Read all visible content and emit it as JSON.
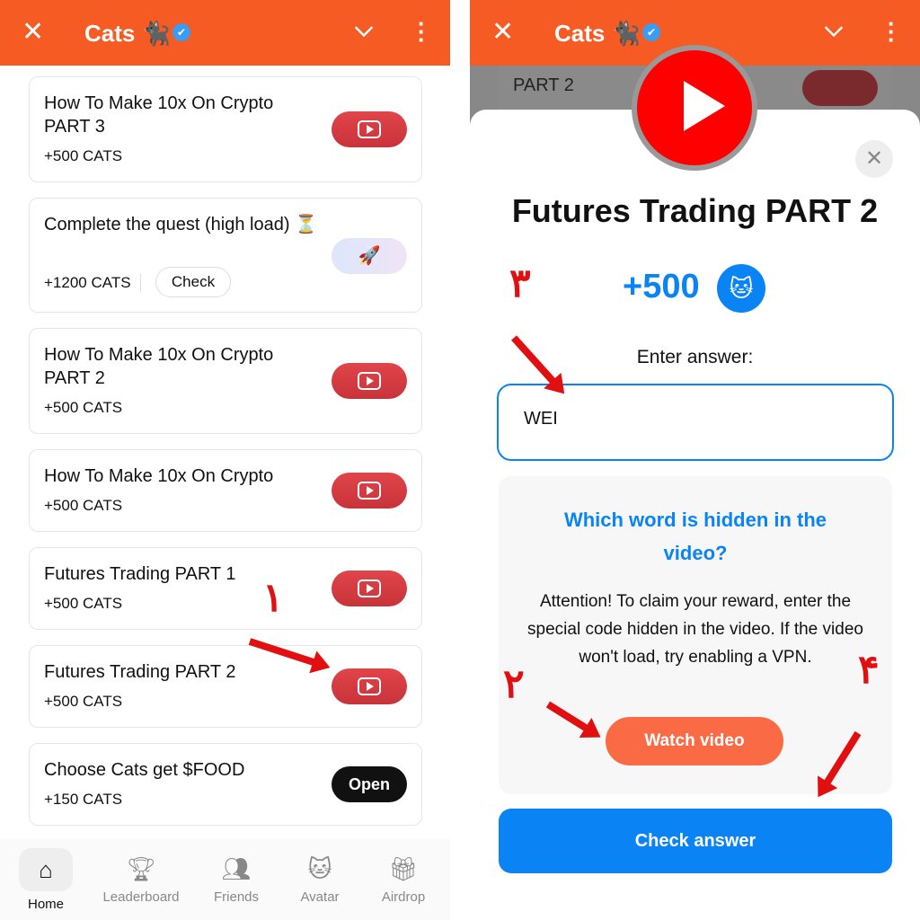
{
  "header": {
    "close": "✕",
    "title": "Cats 🐈‍⬛",
    "verified": "✔",
    "menu": "⋮"
  },
  "tasks": [
    {
      "title": "How To Make 10x On Crypto PART 3",
      "reward": "+500 CATS",
      "action": "youtube"
    },
    {
      "title": "Complete the quest (high load) ⏳",
      "reward": "+1200 CATS",
      "check": "Check",
      "action": "rocket",
      "icon": "🚀"
    },
    {
      "title": "How To Make 10x On Crypto PART 2",
      "reward": "+500 CATS",
      "action": "youtube"
    },
    {
      "title": "How To Make 10x On Crypto",
      "reward": "+500 CATS",
      "action": "youtube"
    },
    {
      "title": "Futures Trading PART 1",
      "reward": "+500 CATS",
      "action": "youtube"
    },
    {
      "title": "Futures Trading PART 2",
      "reward": "+500 CATS",
      "action": "youtube"
    },
    {
      "title": "Choose Cats get $FOOD",
      "reward": "+150 CATS",
      "open": "Open"
    }
  ],
  "nav": [
    {
      "label": "Home",
      "icon": "home-icon",
      "active": true
    },
    {
      "label": "Leaderboard",
      "icon": "trophy-icon"
    },
    {
      "label": "Friends",
      "icon": "friends-icon"
    },
    {
      "label": "Avatar",
      "icon": "cat-icon"
    },
    {
      "label": "Airdrop",
      "icon": "gift-icon"
    }
  ],
  "behind": {
    "text": "PART 2"
  },
  "modal": {
    "title": "Futures Trading PART 2",
    "reward": "+500",
    "answer_label": "Enter answer:",
    "answer_value": "WEI",
    "question": "Which word is hidden in the video?",
    "attention": "Attention! To claim your reward, enter the special code hidden in the video. If the video won't load, try enabling a VPN.",
    "watch": "Watch video",
    "check": "Check answer",
    "close": "✕"
  },
  "annotations": [
    "١",
    "٢",
    "٣",
    "۴"
  ],
  "colors": {
    "header": "#F55B23",
    "accent": "#0A84F5",
    "youtube": "#E0454A",
    "watch": "#F96A45"
  }
}
